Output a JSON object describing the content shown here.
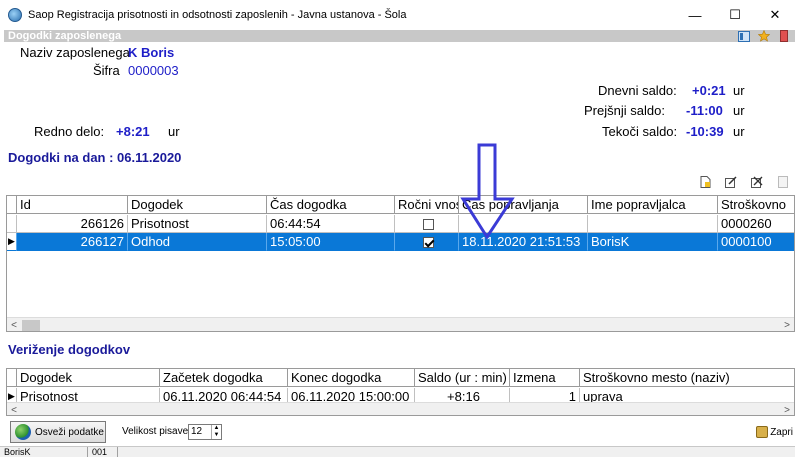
{
  "window": {
    "title": "Saop Registracija prisotnosti in odsotnosti zaposlenih - Javna ustanova - Šola",
    "minimize": "—",
    "maximize": "☐",
    "close": "✕"
  },
  "header": {
    "title": "Dogodki zaposlenega"
  },
  "employee": {
    "name_label": "Naziv zaposlenega",
    "name_value": "K Boris",
    "code_label": "Šifra",
    "code_value": "0000003",
    "regular_label": "Redno delo:",
    "regular_value": "+8:21",
    "regular_unit": "ur"
  },
  "balances": {
    "daily_label": "Dnevni saldo:",
    "daily_value": "+0:21",
    "previous_label": "Prejšnji saldo:",
    "previous_value": "-11:00",
    "current_label": "Tekoči saldo:",
    "current_value": "-10:39",
    "unit": "ur"
  },
  "events_section": {
    "title": "Dogodki na dan : 06.11.2020",
    "columns": [
      "Id",
      "Dogodek",
      "Čas dogodka",
      "Ročni vnos",
      "Čas popravljanja",
      "Ime popravljalca",
      "Stroškovno"
    ],
    "rows": [
      {
        "id": "266126",
        "event": "Prisotnost",
        "time": "06:44:54",
        "manual": false,
        "corrected": "",
        "corrector": "",
        "cost": "0000260"
      },
      {
        "id": "266127",
        "event": "Odhod",
        "time": "15:05:00",
        "manual": true,
        "corrected": "18.11.2020 21:51:53",
        "corrector": "BorisK",
        "cost": "0000100"
      }
    ]
  },
  "chain_section": {
    "title": "Veriženje dogodkov",
    "columns": [
      "Dogodek",
      "Začetek dogodka",
      "Konec dogodka",
      "Saldo (ur : min)",
      "Izmena",
      "Stroškovno mesto (naziv)"
    ],
    "rows": [
      {
        "event": "Prisotnost",
        "start": "06.11.2020 06:44:54",
        "end": "06.11.2020 15:00:00",
        "balance": "+8:16",
        "shift": "1",
        "cost_center": "uprava"
      }
    ]
  },
  "bottom": {
    "refresh_label": "Osveži podatke",
    "font_size_label": "Velikost pisave:",
    "font_size_value": "12",
    "close_label": "Zapri"
  },
  "status": {
    "user": "BorisK",
    "code": "001"
  },
  "colors": {
    "accent_blue": "#1e1ec8",
    "selection": "#0a78d7",
    "section_title": "#1a1a9a",
    "annotation_arrow": "#3b3bd6"
  }
}
